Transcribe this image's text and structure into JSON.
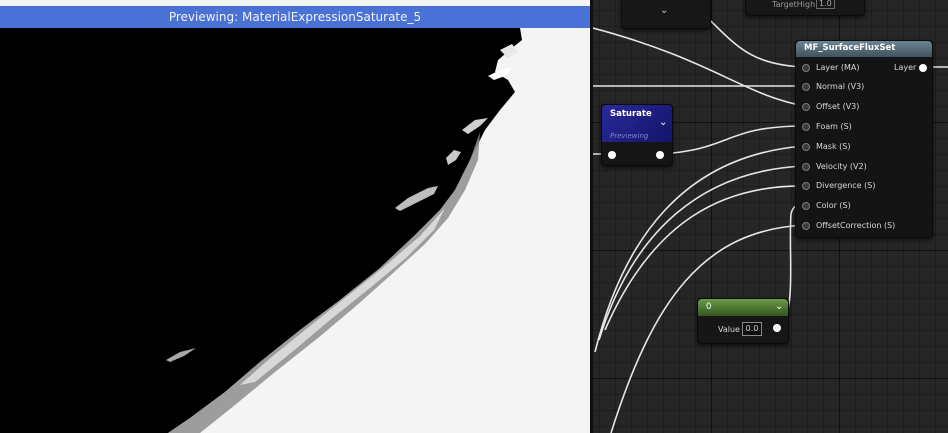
{
  "viewport": {
    "banner": "Previewing: MaterialExpressionSaturate_5"
  },
  "graph": {
    "top_right_node": {
      "label": "TargetHigh",
      "value": "1.0"
    },
    "surface_flux_node": {
      "title": "MF_SurfaceFluxSet",
      "output_label": "Layer",
      "inputs": [
        "Layer (MA)",
        "Normal (V3)",
        "Offset (V3)",
        "Foam (S)",
        "Mask (S)",
        "Velocity (V2)",
        "Divergence (S)",
        "Color (S)",
        "OffsetCorrection (S)"
      ]
    },
    "saturate_node": {
      "title": "Saturate",
      "subtitle": "Previewing"
    },
    "constant_node": {
      "title": "0",
      "value_label": "Value",
      "value": "0.0"
    }
  },
  "colors": {
    "banner": "#4a72d6",
    "saturate_header": "#2a2a9c",
    "constant_header": "#6a9c48",
    "function_header": "#6b8594",
    "wire": "#e6e6e6"
  }
}
